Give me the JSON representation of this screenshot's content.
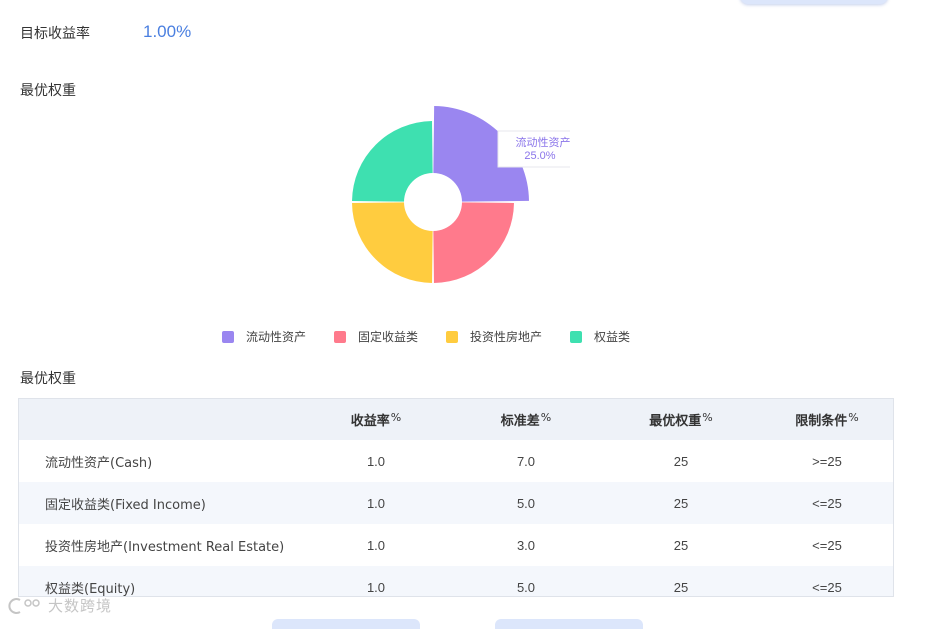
{
  "target": {
    "label": "目标收益率",
    "value": "1.00%"
  },
  "section1_title": "最优权重",
  "section2_title": "最优权重",
  "chart_data": {
    "type": "pie",
    "variant": "rose-donut",
    "categories": [
      "流动性资产",
      "固定收益类",
      "投资性房地产",
      "权益类"
    ],
    "values": [
      25,
      25,
      25,
      25
    ],
    "colors": [
      "#9a86f0",
      "#ff7a8c",
      "#ffcc3f",
      "#3ee0b0"
    ],
    "highlighted": 0,
    "tooltip": {
      "name": "流动性资产",
      "value": "25.0%"
    },
    "legend_position": "bottom"
  },
  "table": {
    "headers": [
      "",
      "收益率",
      "标准差",
      "最优权重",
      "限制条件"
    ],
    "header_suffix": "%",
    "rows": [
      {
        "name": "流动性资产(Cash)",
        "return": "1.0",
        "std": "7.0",
        "weight": "25",
        "limit": ">=25"
      },
      {
        "name": "固定收益类(Fixed Income)",
        "return": "1.0",
        "std": "5.0",
        "weight": "25",
        "limit": "<=25"
      },
      {
        "name": "投资性房地产(Investment Real Estate)",
        "return": "1.0",
        "std": "3.0",
        "weight": "25",
        "limit": "<=25"
      },
      {
        "name": "权益类(Equity)",
        "return": "1.0",
        "std": "5.0",
        "weight": "25",
        "limit": "<=25"
      }
    ]
  },
  "watermark": "大数跨境"
}
